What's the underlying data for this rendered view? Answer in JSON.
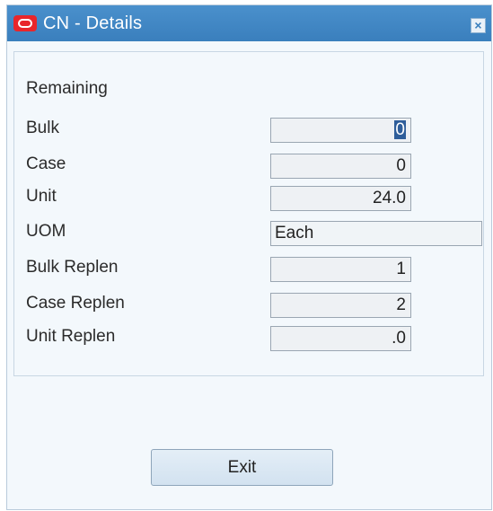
{
  "window": {
    "title": "CN - Details",
    "close_icon": "close-icon"
  },
  "form": {
    "section_label": "Remaining",
    "fields": [
      {
        "label": "Bulk",
        "value": "0",
        "focused": true
      },
      {
        "label": "Case",
        "value": "0"
      },
      {
        "label": "Unit",
        "value": "24.0"
      },
      {
        "label": "UOM",
        "value": "Each"
      },
      {
        "label": "Bulk Replen",
        "value": "1"
      },
      {
        "label": "Case Replen",
        "value": "2"
      },
      {
        "label": "Unit Replen",
        "value": ".0"
      }
    ]
  },
  "footer": {
    "exit_label": "Exit"
  }
}
